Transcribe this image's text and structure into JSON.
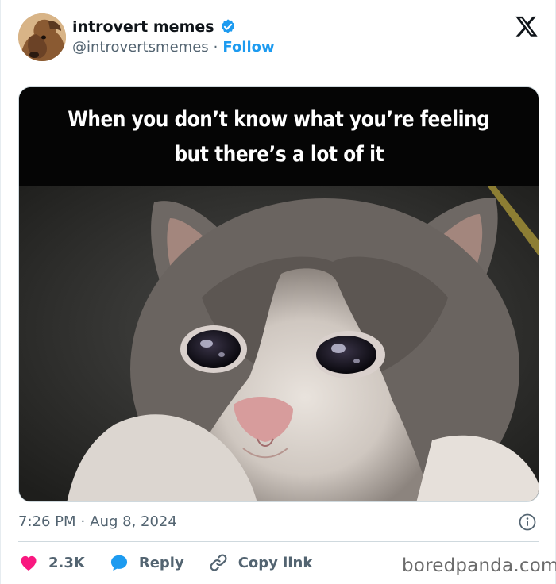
{
  "author": {
    "display_name": "introvert memes",
    "handle": "@introvertsmemes",
    "separator": "·",
    "follow_label": "Follow",
    "verified_color": "#1d9bf0"
  },
  "media": {
    "caption_line1": "When you don’t know what you’re feeling",
    "caption_line2": "but there’s a lot of it"
  },
  "timestamp": {
    "time": "7:26 PM",
    "separator": "·",
    "date": "Aug 8, 2024"
  },
  "actions": {
    "like_count": "2.3K",
    "reply_label": "Reply",
    "copy_link_label": "Copy link"
  },
  "icons": {
    "like": "heart-icon",
    "reply": "speech-bubble-icon",
    "copy": "link-icon",
    "info": "info-icon",
    "platform": "x-logo-icon"
  },
  "colors": {
    "like": "#f91880",
    "reply": "#1d9bf0",
    "link": "#1d9bf0"
  },
  "watermark": "boredpanda.com"
}
